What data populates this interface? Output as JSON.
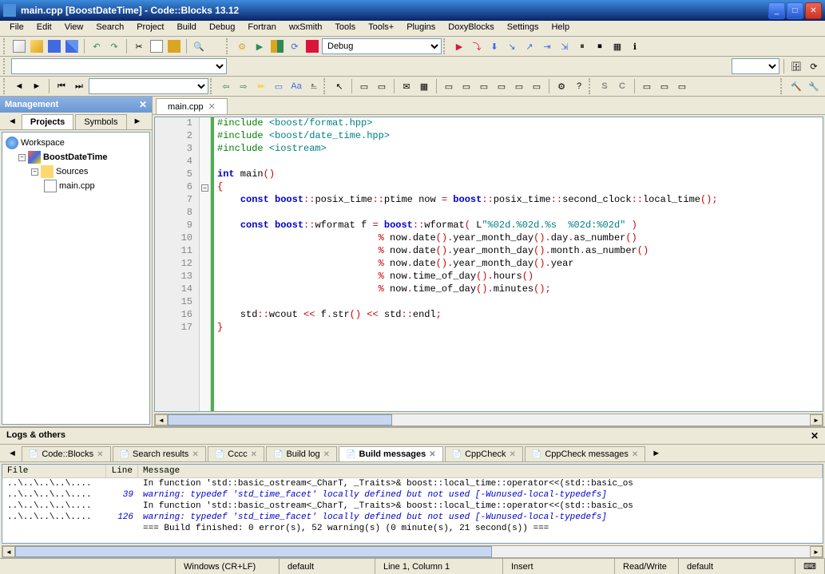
{
  "titlebar": {
    "title": "main.cpp [BoostDateTime] - Code::Blocks 13.12"
  },
  "menubar": [
    "File",
    "Edit",
    "View",
    "Search",
    "Project",
    "Build",
    "Debug",
    "Fortran",
    "wxSmith",
    "Tools",
    "Tools+",
    "Plugins",
    "DoxyBlocks",
    "Settings",
    "Help"
  ],
  "toolbar": {
    "build_target": "Debug"
  },
  "mgmt": {
    "title": "Management",
    "tabs": [
      "Projects",
      "Symbols"
    ],
    "active_tab": 0,
    "tree": {
      "workspace": "Workspace",
      "project": "BoostDateTime",
      "sources": "Sources",
      "file": "main.cpp"
    }
  },
  "editor": {
    "tab": "main.cpp",
    "lines": [
      {
        "n": 1,
        "html": "<span class='pp'>#include</span> <span class='str'>&lt;boost/format.hpp&gt;</span>"
      },
      {
        "n": 2,
        "html": "<span class='pp'>#include</span> <span class='str'>&lt;boost/date_time.hpp&gt;</span>"
      },
      {
        "n": 3,
        "html": "<span class='pp'>#include</span> <span class='str'>&lt;iostream&gt;</span>"
      },
      {
        "n": 4,
        "html": ""
      },
      {
        "n": 5,
        "html": "<span class='kw'>int</span> main<span class='op'>()</span>"
      },
      {
        "n": 6,
        "html": "<span class='op'>{</span>",
        "fold": "-"
      },
      {
        "n": 7,
        "html": "    <span class='kw'>const</span> <span class='kw'>boost</span><span class='op'>::</span>posix_time<span class='op'>::</span>ptime now <span class='op'>=</span> <span class='kw'>boost</span><span class='op'>::</span>posix_time<span class='op'>::</span>second_clock<span class='op'>::</span>local_time<span class='op'>();</span>"
      },
      {
        "n": 8,
        "html": ""
      },
      {
        "n": 9,
        "html": "    <span class='kw'>const</span> <span class='kw'>boost</span><span class='op'>::</span>wformat f <span class='op'>=</span> <span class='kw'>boost</span><span class='op'>::</span>wformat<span class='op'>(</span> L<span class='str'>\"%02d.%02d.%s  %02d:%02d\"</span> <span class='op'>)</span>"
      },
      {
        "n": 10,
        "html": "                            <span class='op'>%</span> now<span class='op'>.</span>date<span class='op'>().</span>year_month_day<span class='op'>().</span>day<span class='op'>.</span>as_number<span class='op'>()</span>"
      },
      {
        "n": 11,
        "html": "                            <span class='op'>%</span> now<span class='op'>.</span>date<span class='op'>().</span>year_month_day<span class='op'>().</span>month<span class='op'>.</span>as_number<span class='op'>()</span>"
      },
      {
        "n": 12,
        "html": "                            <span class='op'>%</span> now<span class='op'>.</span>date<span class='op'>().</span>year_month_day<span class='op'>().</span>year"
      },
      {
        "n": 13,
        "html": "                            <span class='op'>%</span> now<span class='op'>.</span>time_of_day<span class='op'>().</span>hours<span class='op'>()</span>"
      },
      {
        "n": 14,
        "html": "                            <span class='op'>%</span> now<span class='op'>.</span>time_of_day<span class='op'>().</span>minutes<span class='op'>();</span>"
      },
      {
        "n": 15,
        "html": ""
      },
      {
        "n": 16,
        "html": "    std<span class='op'>::</span>wcout <span class='op'>&lt;&lt;</span> f<span class='op'>.</span>str<span class='op'>()</span> <span class='op'>&lt;&lt;</span> std<span class='op'>::</span>endl<span class='op'>;</span>"
      },
      {
        "n": 17,
        "html": "<span class='op'>}</span>"
      }
    ]
  },
  "logs": {
    "title": "Logs & others",
    "tabs": [
      "Code::Blocks",
      "Search results",
      "Cccc",
      "Build log",
      "Build messages",
      "CppCheck",
      "CppCheck messages"
    ],
    "active_tab": 4,
    "columns": [
      "File",
      "Line",
      "Message"
    ],
    "rows": [
      {
        "file": "..\\..\\..\\..\\....",
        "line": "",
        "msg": "In function 'std::basic_ostream<_CharT, _Traits>& boost::local_time::operator<<(std::basic_os",
        "cls": ""
      },
      {
        "file": "..\\..\\..\\..\\....",
        "line": "39",
        "msg": "warning: typedef 'std_time_facet' locally defined but not used [-Wunused-local-typedefs]",
        "cls": "warn"
      },
      {
        "file": "..\\..\\..\\..\\....",
        "line": "",
        "msg": "In function 'std::basic_ostream<_CharT, _Traits>& boost::local_time::operator<<(std::basic_os",
        "cls": ""
      },
      {
        "file": "..\\..\\..\\..\\....",
        "line": "126",
        "msg": "warning: typedef 'std_time_facet' locally defined but not used [-Wunused-local-typedefs]",
        "cls": "warn"
      },
      {
        "file": "",
        "line": "",
        "msg": "=== Build finished: 0 error(s), 52 warning(s) (0 minute(s), 21 second(s)) ===",
        "cls": ""
      }
    ]
  },
  "statusbar": {
    "encoding": "Windows (CR+LF)",
    "s2": "default",
    "position": "Line 1, Column 1",
    "mode": "Insert",
    "perm": "Read/Write",
    "s6": "default"
  }
}
